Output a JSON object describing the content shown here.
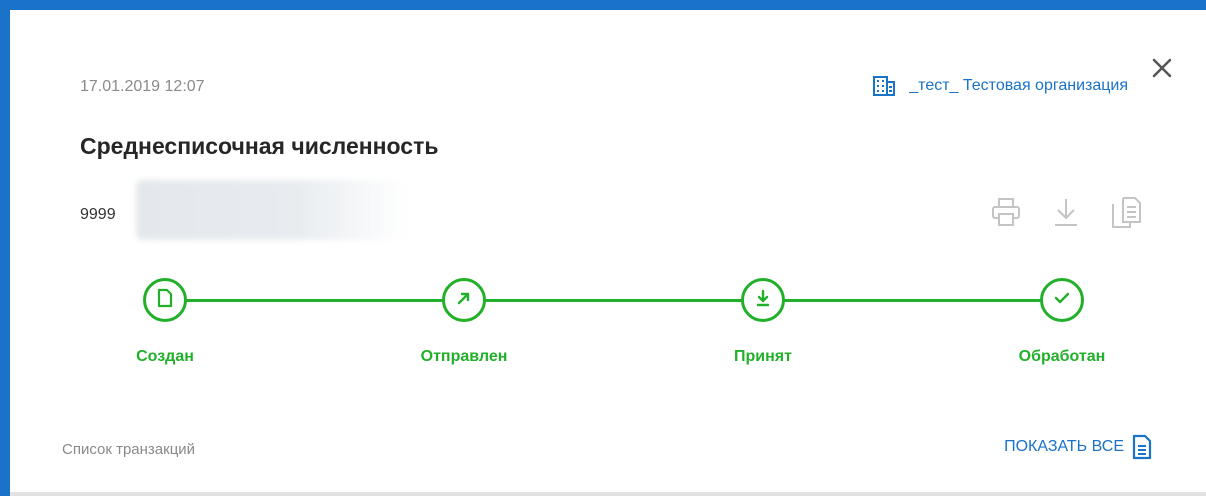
{
  "header": {
    "date": "17.01.2019 12:07",
    "organization": "_тест_ Тестовая организация"
  },
  "document": {
    "title": "Среднесписочная численность",
    "number": "9999"
  },
  "status_steps": [
    {
      "label": "Создан",
      "icon": "document-icon",
      "completed": true
    },
    {
      "label": "Отправлен",
      "icon": "arrow-up-right-icon",
      "completed": true
    },
    {
      "label": "Принят",
      "icon": "download-icon",
      "completed": true
    },
    {
      "label": "Обработан",
      "icon": "check-icon",
      "completed": true
    }
  ],
  "actions": [
    {
      "icon": "print-icon"
    },
    {
      "icon": "download-icon"
    },
    {
      "icon": "copy-icon"
    }
  ],
  "footer": {
    "transactions_label": "Список транзакций",
    "show_all": "ПОКАЗАТЬ ВСЕ"
  },
  "colors": {
    "accent": "#1a72c9",
    "success": "#22b02a",
    "muted": "#8a8a8a",
    "icon_disabled": "#c4c4c4"
  }
}
